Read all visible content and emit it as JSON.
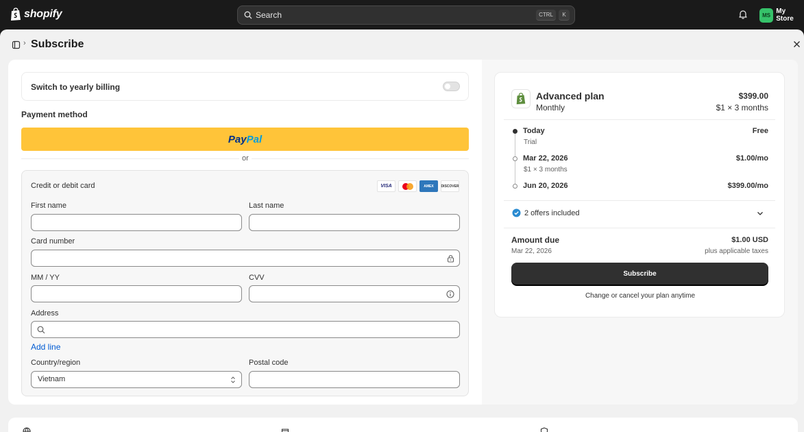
{
  "topbar": {
    "brand": "shopify",
    "search_placeholder": "Search",
    "kbd_ctrl": "CTRL",
    "kbd_k": "K",
    "avatar_initials": "MS",
    "store_name": "My Store"
  },
  "page": {
    "title": "Subscribe"
  },
  "billing": {
    "yearly_label": "Switch to yearly billing",
    "yearly_enabled": false
  },
  "payment": {
    "title": "Payment method",
    "paypal_part1": "Pay",
    "paypal_part2": "Pal",
    "or_text": "or",
    "card_title": "Credit or debit card",
    "brands": [
      "VISA",
      "mastercard",
      "AMERICAN EXPRESS",
      "DISCOVER"
    ],
    "first_name_label": "First name",
    "last_name_label": "Last name",
    "card_number_label": "Card number",
    "expiry_label": "MM / YY",
    "cvv_label": "CVV",
    "address_label": "Address",
    "add_line": "Add line",
    "country_label": "Country/region",
    "country_value": "Vietnam",
    "postal_label": "Postal code"
  },
  "summary": {
    "plan_name": "Advanced plan",
    "plan_cycle": "Monthly",
    "plan_price": "$399.00",
    "plan_rate": "$1 × 3 months",
    "timeline": [
      {
        "date": "Today",
        "sub": "Trial",
        "amount": "Free"
      },
      {
        "date": "Mar 22, 2026",
        "sub": "$1 × 3 months",
        "amount": "$1.00/mo"
      },
      {
        "date": "Jun 20, 2026",
        "sub": "",
        "amount": "$399.00/mo"
      }
    ],
    "offers": "2 offers included",
    "amount_due_label": "Amount due",
    "amount_due_date": "Mar 22, 2026",
    "amount_due_value": "$1.00 USD",
    "tax_note": "plus applicable taxes",
    "subscribe_label": "Subscribe",
    "change_note": "Change or cancel your plan anytime"
  },
  "colors": {
    "paypal_yellow": "#ffc439",
    "primary_button": "#303030",
    "link_blue": "#005bd3",
    "avatar_green": "#36c26a",
    "check_blue": "#2a8bd1"
  }
}
